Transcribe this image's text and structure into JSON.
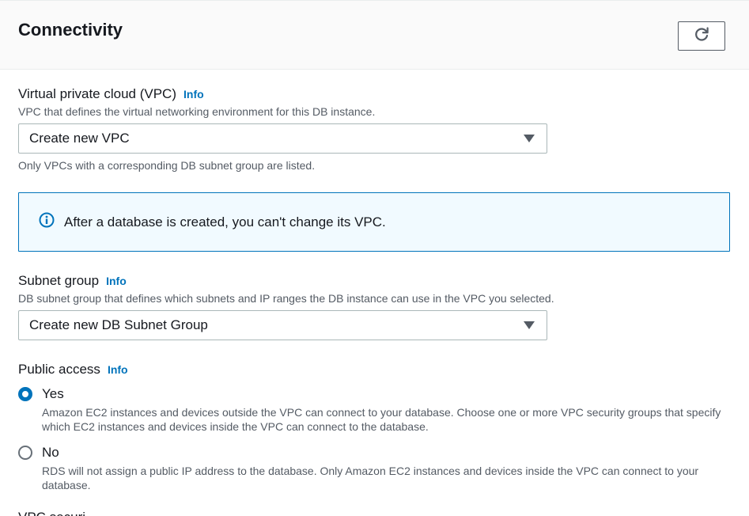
{
  "header": {
    "title": "Connectivity",
    "refresh_icon": "refresh-icon"
  },
  "vpc": {
    "label": "Virtual private cloud (VPC)",
    "info": "Info",
    "description": "VPC that defines the virtual networking environment for this DB instance.",
    "selected": "Create new VPC",
    "helper": "Only VPCs with a corresponding DB subnet group are listed."
  },
  "alert": {
    "icon": "info-circle-icon",
    "text": "After a database is created, you can't change its VPC.",
    "color": "#0073bb"
  },
  "subnet": {
    "label": "Subnet group",
    "info": "Info",
    "description": "DB subnet group that defines which subnets and IP ranges the DB instance can use in the VPC you selected.",
    "selected": "Create new DB Subnet Group"
  },
  "public_access": {
    "label": "Public access",
    "info": "Info",
    "options": [
      {
        "label": "Yes",
        "checked": true,
        "description": "Amazon EC2 instances and devices outside the VPC can connect to your database. Choose one or more VPC security groups that specify which EC2 instances and devices inside the VPC can connect to the database."
      },
      {
        "label": "No",
        "checked": false,
        "description": "RDS will not assign a public IP address to the database. Only Amazon EC2 instances and devices inside the VPC can connect to your database."
      }
    ]
  },
  "next_section": {
    "label_partial": "VPC securi"
  }
}
